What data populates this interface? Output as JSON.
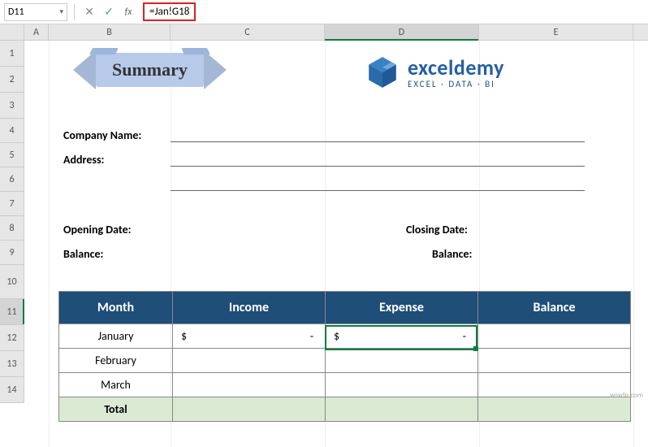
{
  "cellRef": "D11",
  "formula": "=Jan!G18",
  "columns": [
    "A",
    "B",
    "C",
    "D",
    "E"
  ],
  "rows": [
    "1",
    "2",
    "3",
    "4",
    "5",
    "6",
    "7",
    "8",
    "9",
    "10",
    "11",
    "12",
    "13",
    "14"
  ],
  "ribbonTitle": "Summary",
  "logo": {
    "main": "exceldemy",
    "sub": "EXCEL · DATA · BI"
  },
  "labels": {
    "company": "Company Name:",
    "address": "Address:",
    "openDate": "Opening Date:",
    "balance1": "Balance:",
    "closeDate": "Closing Date:",
    "balance2": "Balance:"
  },
  "table": {
    "headers": [
      "Month",
      "Income",
      "Expense",
      "Balance"
    ],
    "rows": [
      {
        "month": "January",
        "income": "$",
        "incomeDash": "-",
        "expense": "$",
        "expenseDash": "-",
        "balance": ""
      },
      {
        "month": "February",
        "income": "",
        "incomeDash": "",
        "expense": "",
        "expenseDash": "",
        "balance": ""
      },
      {
        "month": "March",
        "income": "",
        "incomeDash": "",
        "expense": "",
        "expenseDash": "",
        "balance": ""
      }
    ],
    "totalLabel": "Total"
  },
  "watermark": "wsxdn.com"
}
